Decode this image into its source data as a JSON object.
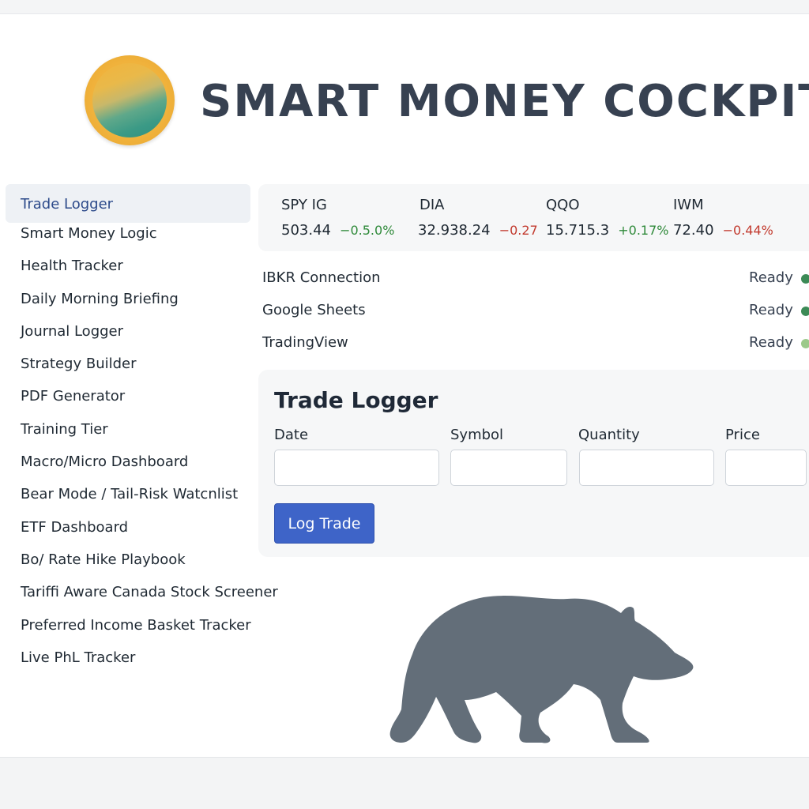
{
  "app": {
    "title": "SMART MONEY COCKPIT"
  },
  "sidebar": {
    "items": [
      {
        "label": "Trade Logger",
        "active": true
      },
      {
        "label": "Smart Money Logic"
      },
      {
        "label": "Health Tracker"
      },
      {
        "label": "Daily Morning Briefing"
      },
      {
        "label": "Journal Logger"
      },
      {
        "label": "Strategy Builder"
      },
      {
        "label": "PDF Generator"
      },
      {
        "label": "Training Tier"
      },
      {
        "label": "Macro/Micro Dashboard"
      },
      {
        "label": "Bear Mode / Tail-Risk Watcnlist"
      },
      {
        "label": "ETF Dashboard"
      },
      {
        "label": "Bo/ Rate Hike Playbook"
      },
      {
        "label": "Tariffi Aware Canada Stock Screener"
      },
      {
        "label": "Preferred Income Basket Tracker"
      },
      {
        "label": "Live PhL Tracker"
      }
    ]
  },
  "ticker": {
    "items": [
      {
        "symbol": "SPY IG",
        "price": "503.44",
        "change": "−0.5.0%",
        "direction": "up"
      },
      {
        "symbol": "DIA",
        "price": "32.938.24",
        "change": "−0.27",
        "direction": "down"
      },
      {
        "symbol": "QQO",
        "price": "15.715.3",
        "change": "+0.17%",
        "direction": "up"
      },
      {
        "symbol": "IWM",
        "price": "72.40",
        "change": "−0.44%",
        "direction": "down"
      }
    ]
  },
  "connections": {
    "items": [
      {
        "name": "IBKR Connection",
        "status": "Ready",
        "dot_color": "#3c8a56"
      },
      {
        "name": "Google Sheets",
        "status": "Ready",
        "dot_color": "#3c8a56"
      },
      {
        "name": "TradingView",
        "status": "Ready",
        "dot_color": "#9cc98a"
      }
    ]
  },
  "trade_logger": {
    "title": "Trade Logger",
    "fields": {
      "date": {
        "label": "Date",
        "value": "",
        "placeholder": ""
      },
      "symbol": {
        "label": "Symbol",
        "value": "",
        "placeholder": ""
      },
      "quantity": {
        "label": "Quantity",
        "value": "",
        "placeholder": ""
      },
      "price": {
        "label": "Price",
        "value": "",
        "placeholder": ""
      }
    },
    "submit_label": "Log Trade"
  },
  "colors": {
    "accent": "#3e64c8",
    "positive": "#2f8a3a",
    "negative": "#c23a2e",
    "bear": "#636e79"
  },
  "icons": {
    "logo": "gradient-coin-logo",
    "mascot": "bear-silhouette"
  }
}
